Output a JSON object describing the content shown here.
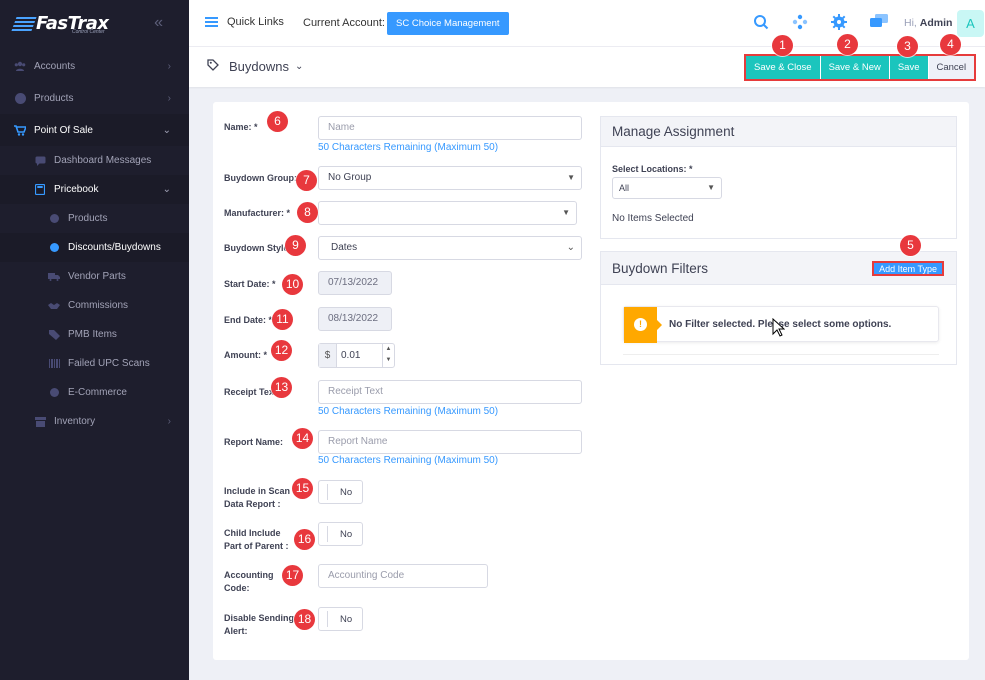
{
  "sidebar": {
    "logo_text": "FasTrax",
    "logo_sub": "Control Center",
    "items": [
      {
        "label": "Accounts"
      },
      {
        "label": "Products"
      },
      {
        "label": "Point Of Sale"
      },
      {
        "label": "Dashboard Messages"
      },
      {
        "label": "Pricebook"
      },
      {
        "label": "Products"
      },
      {
        "label": "Discounts/Buydowns"
      },
      {
        "label": "Vendor Parts"
      },
      {
        "label": "Commissions"
      },
      {
        "label": "PMB Items"
      },
      {
        "label": "Failed UPC Scans"
      },
      {
        "label": "E-Commerce"
      },
      {
        "label": "Inventory"
      }
    ]
  },
  "header": {
    "quick_links": "Quick Links",
    "current_account_label": "Current Account:",
    "current_account": "SC Choice Management",
    "hi": "Hi,",
    "user": "Admin",
    "avatar": "A"
  },
  "subheader": {
    "title": "Buydowns",
    "save_close": "Save & Close",
    "save_new": "Save & New",
    "save": "Save",
    "cancel": "Cancel"
  },
  "form": {
    "name_label": "Name: *",
    "name_placeholder": "Name",
    "name_hint": "50 Characters Remaining (Maximum 50)",
    "group_label": "Buydown Group:",
    "group_value": "No Group",
    "manufacturer_label": "Manufacturer: *",
    "style_label": "Buydown Style:",
    "style_value": "Dates",
    "start_label": "Start Date: *",
    "start_value": "07/13/2022",
    "end_label": "End Date: *",
    "end_value": "08/13/2022",
    "amount_label": "Amount: *",
    "amount_currency": "$",
    "amount_value": "0.01",
    "receipt_label": "Receipt Text:",
    "receipt_placeholder": "Receipt Text",
    "receipt_hint": "50 Characters Remaining (Maximum 50)",
    "report_label": "Report Name:",
    "report_placeholder": "Report Name",
    "report_hint": "50 Characters Remaining (Maximum 50)",
    "scan_label_1": "Include in Scan",
    "scan_label_2": "Data Report :",
    "scan_value": "No",
    "child_label_1": "Child Include",
    "child_label_2": "Part of Parent :",
    "child_value": "No",
    "acct_label_1": "Accounting",
    "acct_label_2": "Code:",
    "acct_placeholder": "Accounting Code",
    "alert_label_1": "Disable Sending",
    "alert_label_2": "Alert:",
    "alert_value": "No"
  },
  "assignment": {
    "title": "Manage Assignment",
    "locations_label": "Select Locations: *",
    "locations_value": "All",
    "none_selected": "No Items Selected"
  },
  "filters": {
    "title": "Buydown Filters",
    "add_button": "Add Item Type",
    "message": "No Filter selected. Please select some options."
  },
  "badges": [
    "1",
    "2",
    "3",
    "4",
    "5",
    "6",
    "7",
    "8",
    "9",
    "10",
    "11",
    "12",
    "13",
    "14",
    "15",
    "16",
    "17",
    "18"
  ],
  "colors": {
    "accent": "#3699ff",
    "teal": "#1bc5bd",
    "badge": "#e8383d",
    "sidebar": "#1e1e2d"
  }
}
